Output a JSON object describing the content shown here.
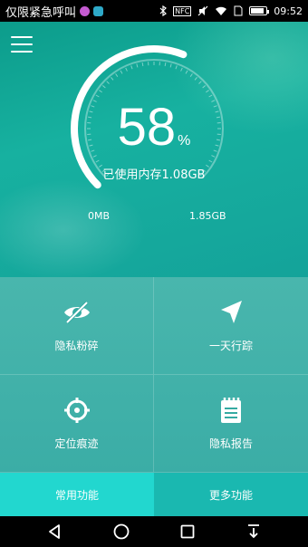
{
  "status_bar": {
    "carrier_text": "仅限紧急呼叫",
    "time": "09:52",
    "nfc_label": "NFC",
    "battery_percent": 85
  },
  "header": {
    "menu_icon": "hamburger-menu-icon"
  },
  "gauge": {
    "percent_value": "58",
    "percent_unit": "%",
    "used_label": "已使用内存1.08GB",
    "min_label": "0MB",
    "max_label": "1.85GB",
    "fill_fraction": 0.58
  },
  "features": [
    {
      "label": "隐私粉碎",
      "icon": "eye-slash-icon"
    },
    {
      "label": "一天行踪",
      "icon": "navigation-arrow-icon"
    },
    {
      "label": "定位痕迹",
      "icon": "crosshair-icon"
    },
    {
      "label": "隐私报告",
      "icon": "notepad-icon"
    }
  ],
  "tabs": [
    {
      "label": "常用功能",
      "active": true
    },
    {
      "label": "更多功能",
      "active": false
    }
  ],
  "colors": {
    "accent": "#22d7cf",
    "tab_inactive": "#1ab8b0",
    "background": "#17b1a0"
  }
}
